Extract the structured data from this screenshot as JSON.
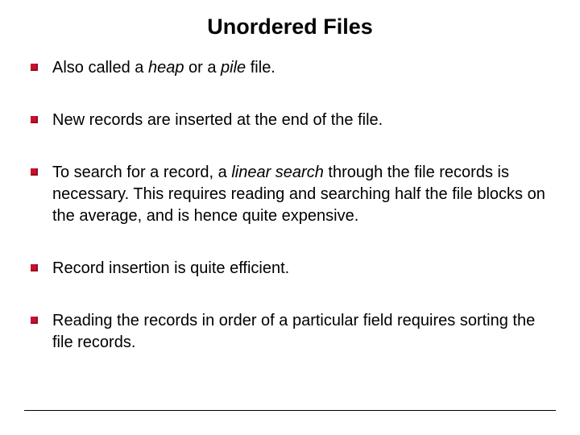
{
  "title": "Unordered Files",
  "bullets": {
    "b1": {
      "p1": "Also called a ",
      "heap": "heap",
      "p2": "  or a ",
      "pile": "pile",
      "p3": "  file."
    },
    "b2": "New records are inserted at the end of the file.",
    "b3": {
      "p1": "To search for a record, a ",
      "linear": "linear search",
      "p2": "  through the file records is necessary. This requires reading and searching half the file blocks on the average, and is hence quite expensive."
    },
    "b4": "Record insertion is quite efficient.",
    "b5": "Reading the records in order of a particular field requires sorting the file records."
  }
}
